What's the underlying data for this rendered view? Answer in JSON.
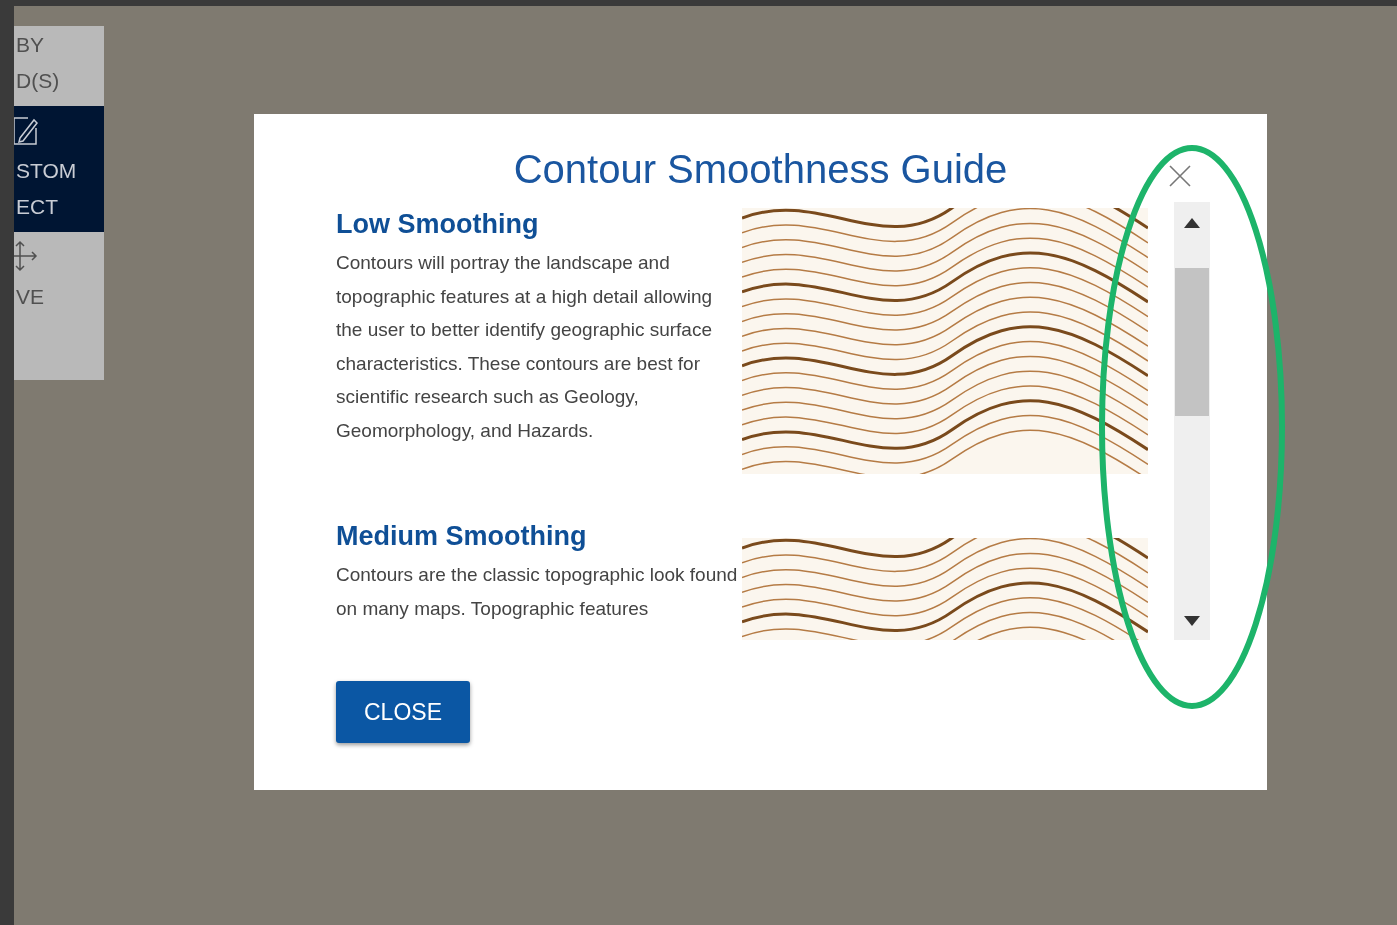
{
  "sidebar": {
    "items": [
      {
        "kind": "none",
        "lines": [
          "BY",
          "D(S)"
        ],
        "selected": false
      },
      {
        "kind": "edit",
        "lines": [
          "STOM",
          "ECT"
        ],
        "selected": true
      },
      {
        "kind": "move",
        "lines": [
          "VE"
        ],
        "selected": false
      }
    ]
  },
  "dialog": {
    "title": "Contour Smoothness Guide",
    "sections": [
      {
        "heading": "Low Smoothing",
        "body": "Contours will portray the landscape and topographic features at a high detail allowing the user to better identify geographic surface characteristics. These contours are best for scientific research such as Geology, Geomorphology, and Hazards."
      },
      {
        "heading": "Medium Smoothing",
        "body": "Contours are the classic topographic look found on many maps. Topographic features"
      }
    ],
    "close_button": "CLOSE"
  }
}
